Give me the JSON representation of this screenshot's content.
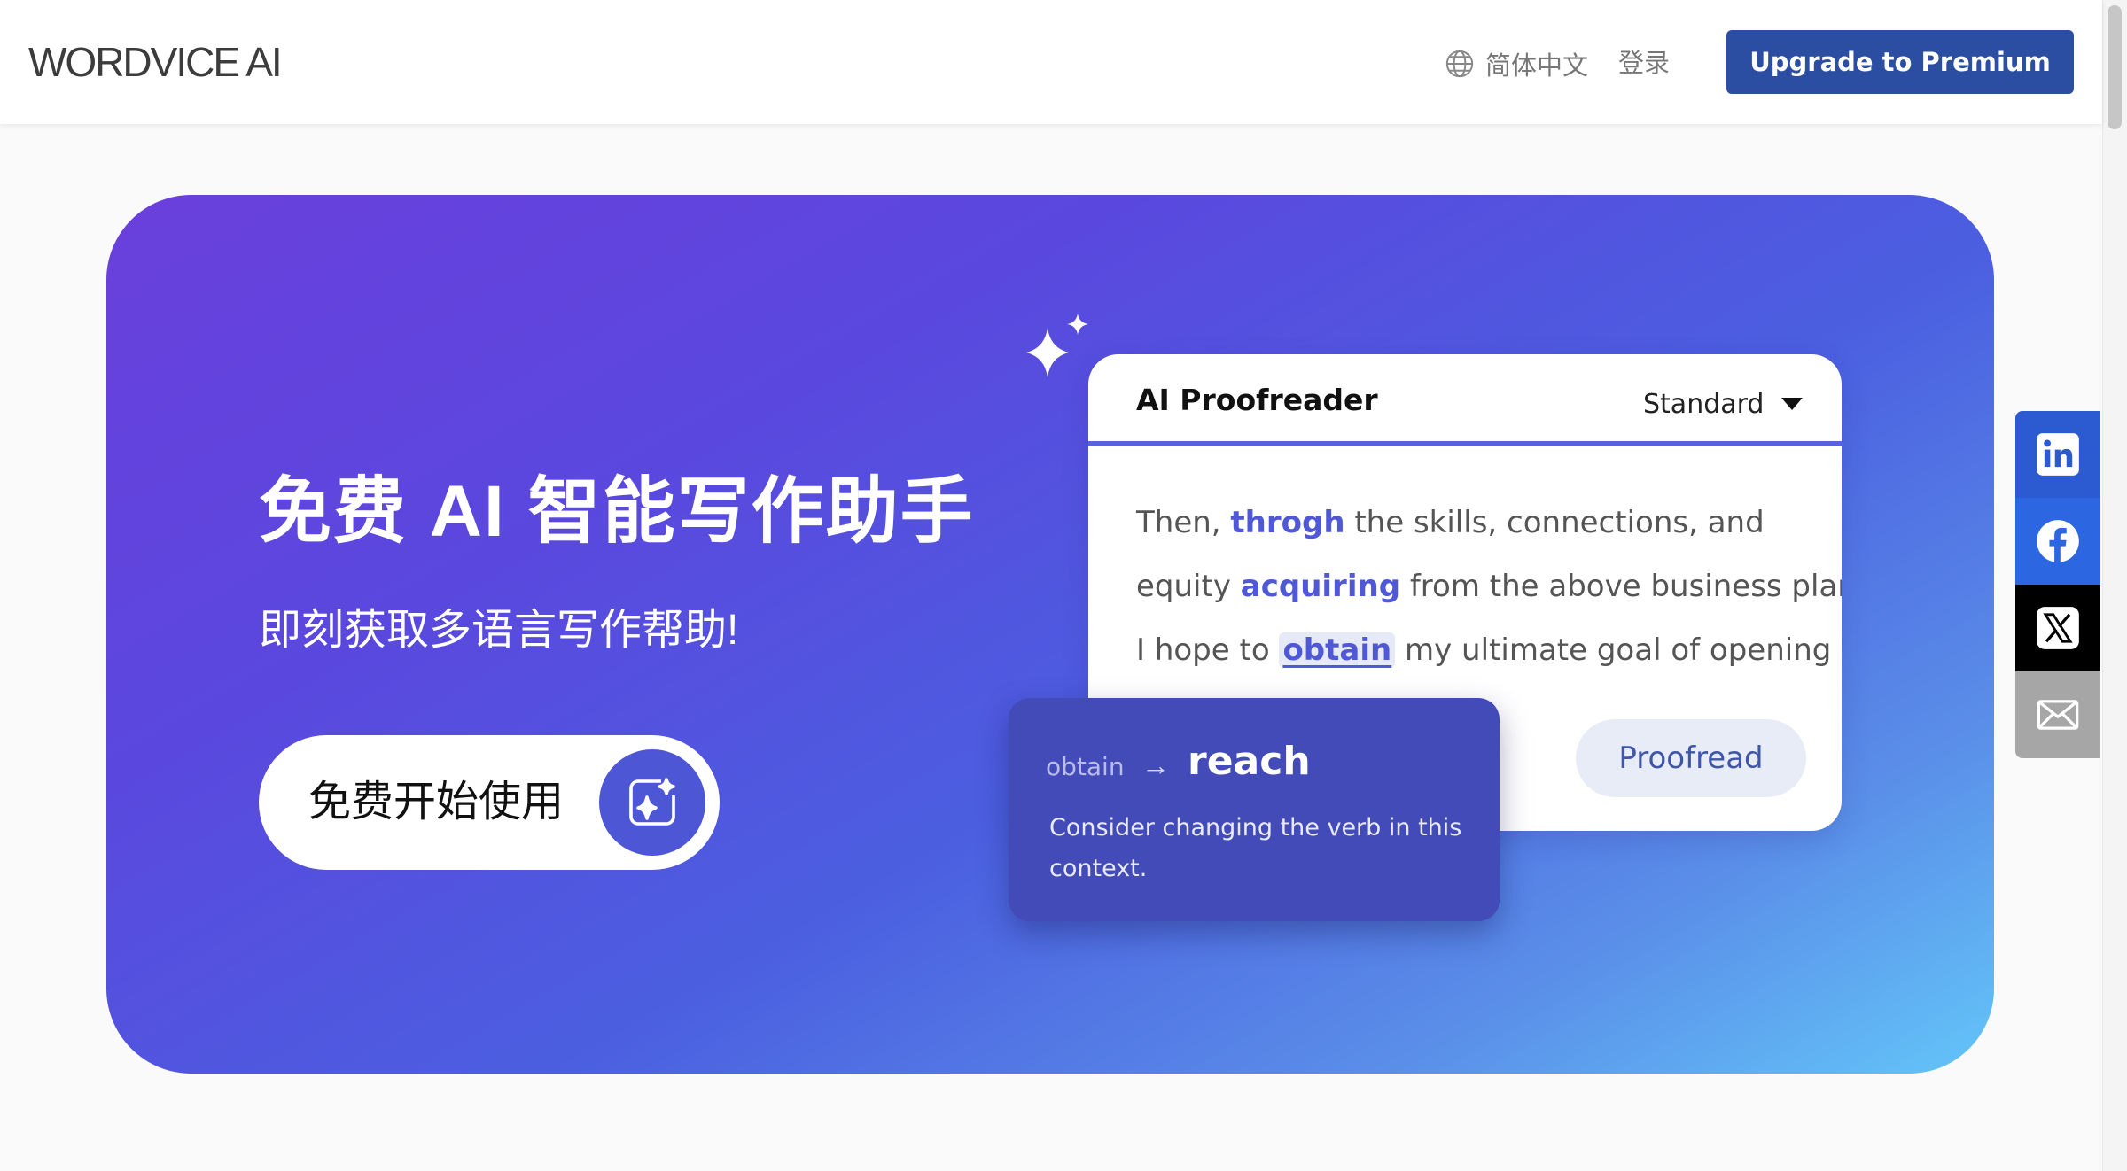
{
  "header": {
    "logo": "WORDVICE AI",
    "language": "简体中文",
    "login": "登录",
    "upgrade_label": "Upgrade to Premium"
  },
  "hero": {
    "title": "免费 AI 智能写作助手",
    "subtitle": "即刻获取多语言写作帮助!",
    "cta_label": "免费开始使用"
  },
  "proofreader": {
    "title": "AI Proofreader",
    "mode": "Standard",
    "lines": [
      {
        "pre": "Then, ",
        "hl": "throgh",
        "post": " the skills, connections, and"
      },
      {
        "pre": "equity ",
        "hl": "acquiring",
        "post": " from the above business plan"
      },
      {
        "pre": "I hope to ",
        "hl": "obtain",
        "post": " my ultimate goal of opening"
      }
    ],
    "button_label": "Proofread"
  },
  "suggestion": {
    "from": "obtain",
    "arrow": "→",
    "to": "reach",
    "message": "Consider changing the verb in this context."
  },
  "social": {
    "icons": [
      "linkedin-icon",
      "facebook-icon",
      "x-icon",
      "mail-icon"
    ],
    "colors": {
      "linkedin": "#2c5ad0",
      "facebook": "#2c66e0",
      "x": "#000000",
      "mail": "#a6a6a6"
    }
  },
  "colors": {
    "brand": "#2b4ea2",
    "accent": "#4f58d6",
    "hero_gradient": [
      "#6a3fdc",
      "#63c5f8"
    ]
  }
}
